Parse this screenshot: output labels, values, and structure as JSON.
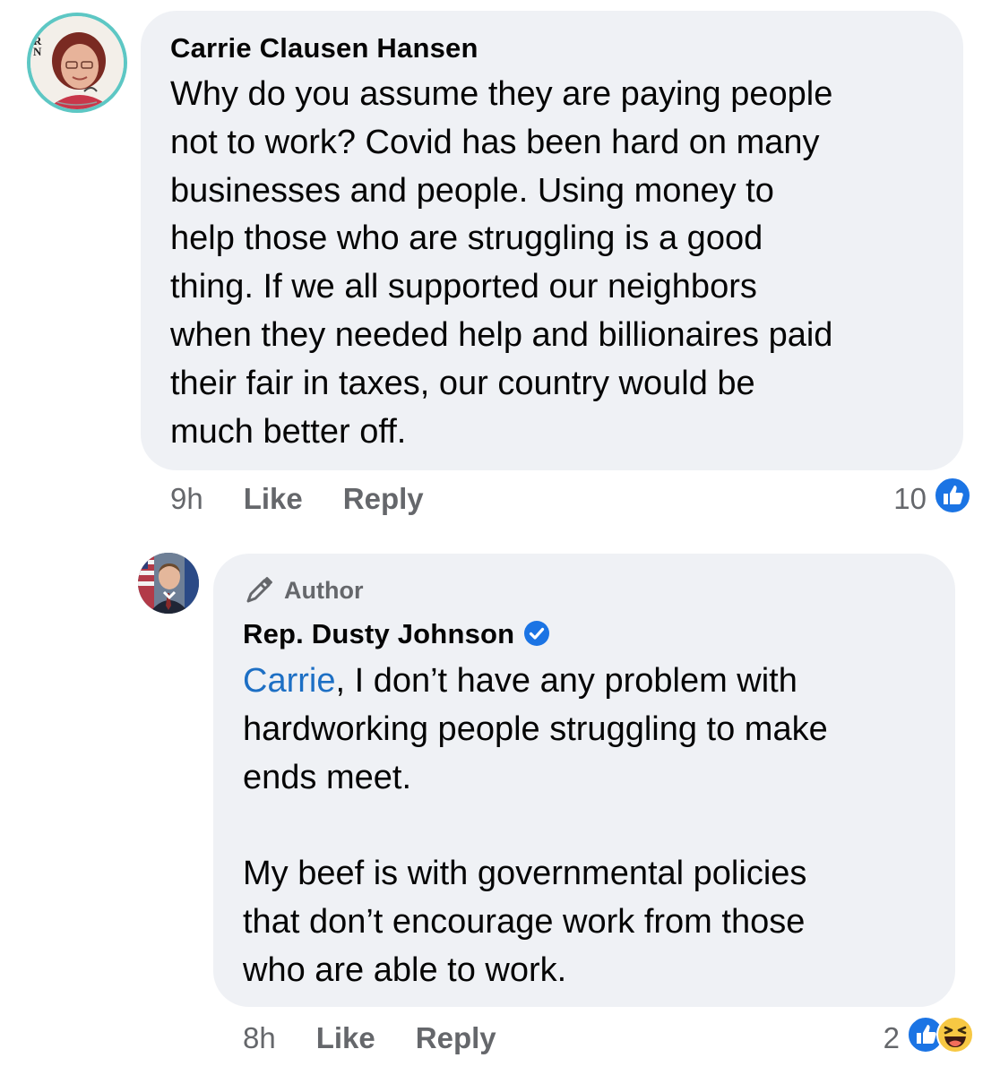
{
  "comments": [
    {
      "author": "Carrie Clausen Hansen",
      "text": "Why do you assume they are paying people\nnot to work? Covid has been hard on many\nbusinesses and people. Using money to\nhelp those who are struggling is a good\nthing. If we all supported our neighbors\nwhen they needed help and billionaires paid\ntheir fair in taxes, our country would be\nmuch better off.",
      "time": "9h",
      "like_label": "Like",
      "reply_label": "Reply",
      "reaction_count": "10",
      "reactions": [
        "like-icon"
      ],
      "avatar_badge": "RN"
    },
    {
      "badge_label": "Author",
      "author": "Rep. Dusty Johnson",
      "verified": true,
      "mention": "Carrie",
      "text_after_mention": ", I don’t have any problem with\nhardworking people struggling to make\nends meet.\n\nMy beef is with governmental policies\nthat don’t encourage work from those\nwho are able to work.",
      "time": "8h",
      "like_label": "Like",
      "reply_label": "Reply",
      "reaction_count": "2",
      "reactions": [
        "like-icon",
        "haha-icon"
      ]
    }
  ],
  "colors": {
    "bubble": "#eff1f5",
    "meta_text": "#65676b",
    "mention": "#1d6fc4",
    "like_blue": "#1b74e4",
    "avatar_ring": "#5dc7c4"
  }
}
